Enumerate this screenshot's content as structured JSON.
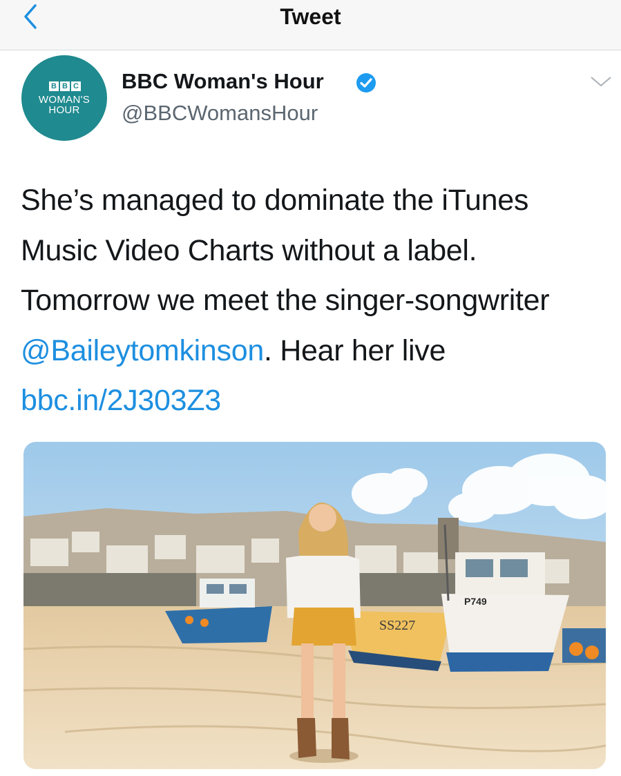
{
  "header": {
    "title": "Tweet",
    "back_icon": "chevron-left-icon"
  },
  "author": {
    "display_name": "BBC Woman's Hour",
    "handle": "@BBCWomansHour",
    "verified": true,
    "avatar": {
      "bbc_letters": [
        "B",
        "B",
        "C"
      ],
      "line1": "WOMAN'S",
      "line2": "HOUR",
      "color": "#1f8a8f"
    }
  },
  "tweet": {
    "text_1": "She’s managed to dominate the iTunes Music Video Charts without a label. Tomorrow we meet the singer-songwriter ",
    "mention": "@Baileytomkinson",
    "text_2": ". Hear her live ",
    "link": "bbc.in/2J303Z3"
  },
  "media": {
    "boat_label_1": "SS227",
    "boat_label_2": "P749"
  },
  "colors": {
    "link": "#1d8fe0",
    "verified": "#1d9bf0",
    "handle": "#5b6670"
  }
}
